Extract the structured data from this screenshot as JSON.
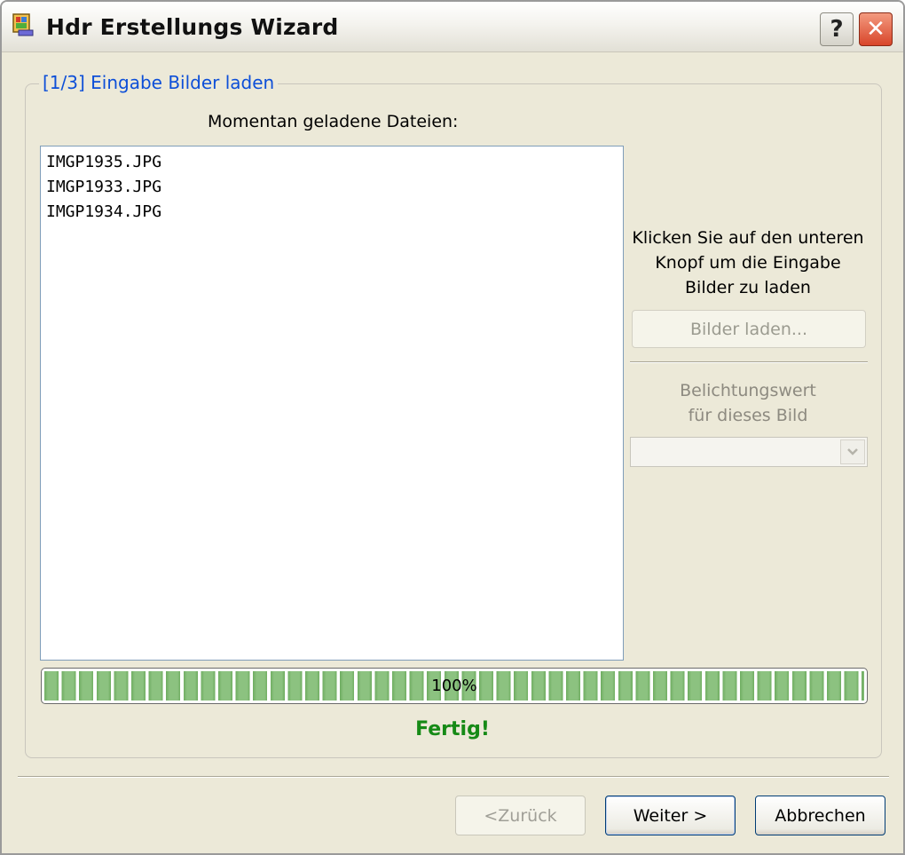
{
  "window": {
    "title": "Hdr Erstellungs Wizard",
    "help_glyph": "?",
    "close_glyph": "✕",
    "icons": [
      "app-icon",
      "help-icon",
      "close-icon",
      "chevron-down-icon"
    ]
  },
  "step": {
    "title": "[1/3] Eingabe Bilder laden",
    "files_label": "Momentan geladene Dateien:",
    "files": [
      "IMGP1935.JPG",
      "IMGP1933.JPG",
      "IMGP1934.JPG"
    ]
  },
  "side": {
    "instruction": "Klicken Sie auf den unteren Knopf um die Eingabe Bilder zu laden",
    "load_button": "Bilder laden...",
    "exposure_label_line1": "Belichtungswert",
    "exposure_label_line2": "für dieses Bild",
    "exposure_value": ""
  },
  "progress": {
    "percent": 100,
    "label": "100%",
    "status": "Fertig!"
  },
  "buttons": {
    "back": "<Zurück",
    "next": "Weiter >",
    "cancel": "Abbrechen"
  },
  "colors": {
    "legend": "#0d4fd8",
    "status": "#168a16",
    "progress": "#8cc280",
    "window_face": "#ece9d8"
  }
}
